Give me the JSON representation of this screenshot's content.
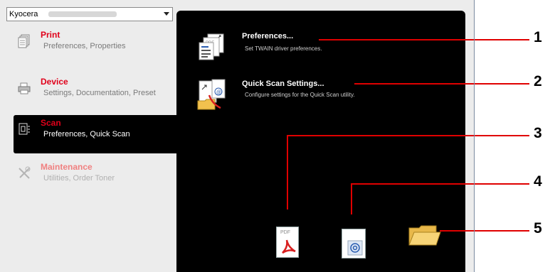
{
  "model_selector": {
    "selected": "Kyocera",
    "redacted": true
  },
  "sidebar": {
    "items": [
      {
        "title": "Print",
        "subtitle": "Preferences, Properties"
      },
      {
        "title": "Device",
        "subtitle": "Settings, Documentation, Preset"
      },
      {
        "title": "Scan",
        "subtitle": "Preferences, Quick Scan"
      },
      {
        "title": "Maintenance",
        "subtitle": "Utilities, Order Toner"
      }
    ]
  },
  "content": {
    "preferences": {
      "title": "Preferences...",
      "desc": "Set TWAIN driver preferences."
    },
    "quick_scan": {
      "title": "Quick Scan Settings...",
      "desc": "Configure settings for the Quick Scan utility."
    },
    "pdf_label": "PDF"
  },
  "callouts": [
    "1",
    "2",
    "3",
    "4",
    "5"
  ],
  "colors": {
    "accent_red": "#e0001a",
    "panel_bg": "#000000",
    "callout_line": "#e00000"
  },
  "icons": [
    "print-icon",
    "device-icon",
    "scan-icon",
    "maintenance-icon",
    "preferences-icon",
    "quick-scan-settings-icon",
    "scan-to-pdf-icon",
    "scan-to-email-icon",
    "scan-to-folder-icon"
  ]
}
